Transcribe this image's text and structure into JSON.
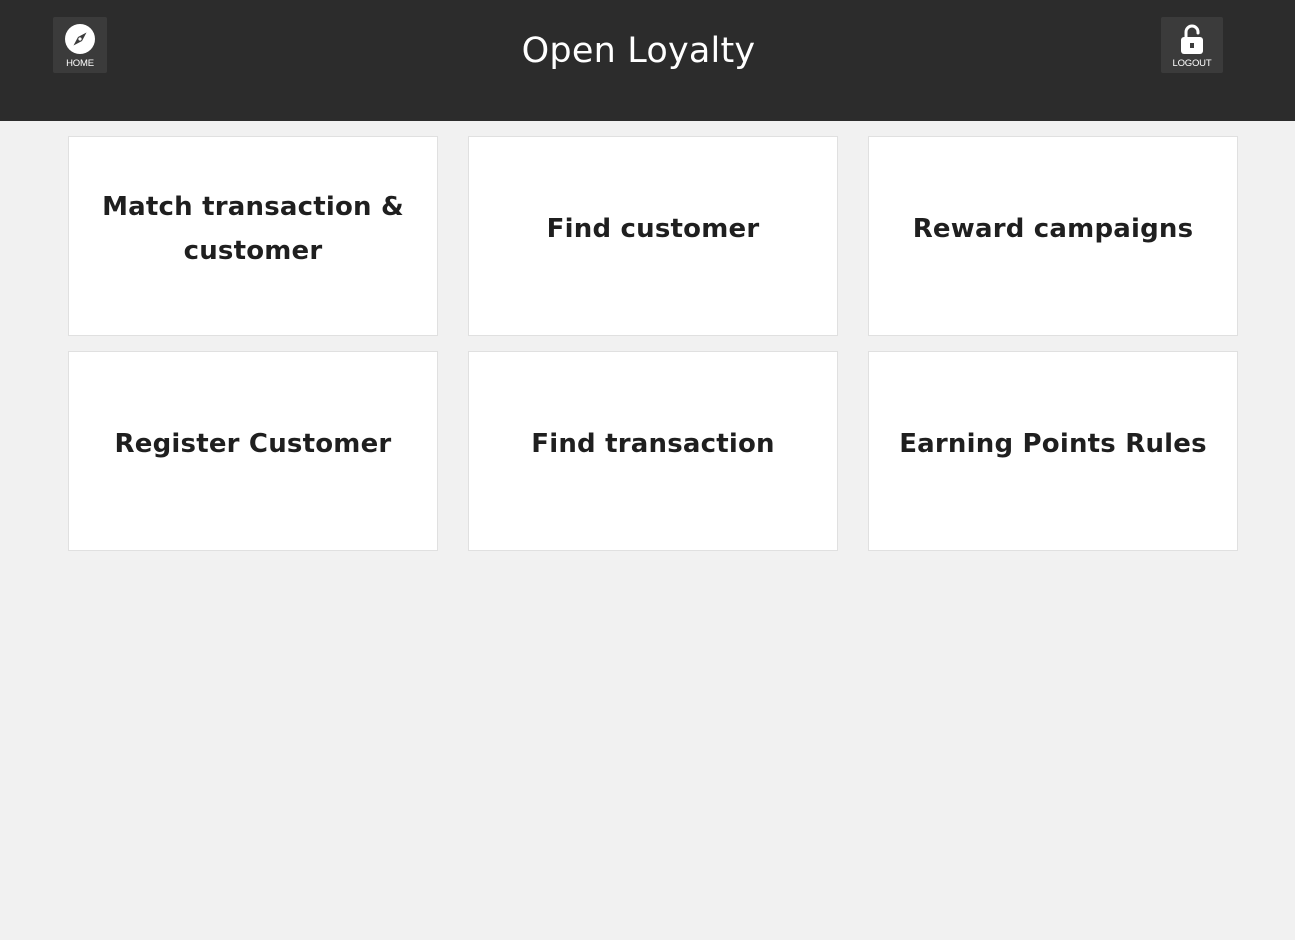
{
  "header": {
    "title": "Open Loyalty",
    "home": {
      "label": "HOME",
      "icon": "compass-icon"
    },
    "logout": {
      "label": "LOGOUT",
      "icon": "unlocked-padlock-icon"
    }
  },
  "tiles": [
    {
      "label": "Match transaction & customer"
    },
    {
      "label": "Find customer"
    },
    {
      "label": "Reward campaigns"
    },
    {
      "label": "Register Customer"
    },
    {
      "label": "Find transaction"
    },
    {
      "label": "Earning Points Rules"
    }
  ],
  "colors": {
    "header_bg": "#2c2c2c",
    "page_bg": "#f1f1f1",
    "tile_bg": "#ffffff",
    "tile_text": "#1f1f1f"
  }
}
